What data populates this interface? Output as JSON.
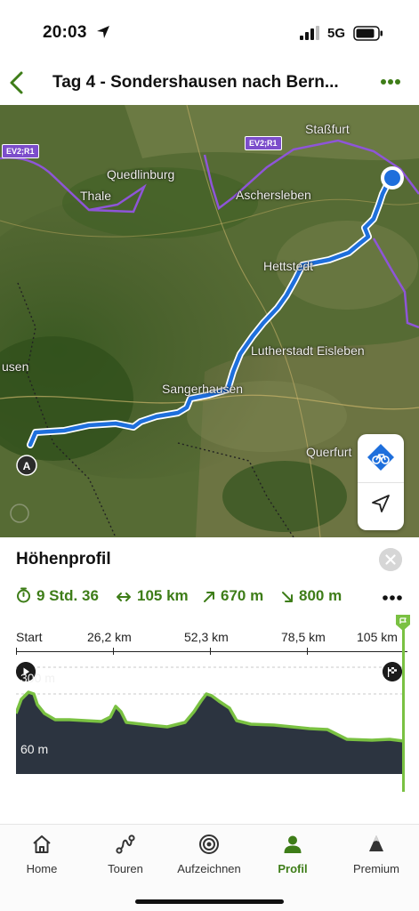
{
  "status_bar": {
    "time": "20:03",
    "network": "5G"
  },
  "nav": {
    "title": "Tag 4 - Sondershausen nach Bern...",
    "back_icon": "chevron-left-icon",
    "more_icon": "more-dots-icon"
  },
  "map": {
    "places": [
      "Staßfurt",
      "Quedlinburg",
      "Thale",
      "Aschersleben",
      "Hettstedt",
      "Lutherstadt Eisleben",
      "Sangerhausen",
      "usen",
      "Querfurt"
    ],
    "route_badges": [
      "EV2;R1",
      "EV2;R1"
    ],
    "start_marker": "A",
    "route_color": "#1e6fdc",
    "boundary_color": "#8e55d8",
    "controls": {
      "bike_icon": "bike-layer-icon",
      "locate_icon": "location-arrow-icon"
    }
  },
  "elevation": {
    "title": "Höhenprofil",
    "stats": {
      "duration": "9 Std. 36",
      "distance": "105 km",
      "ascent": "670 m",
      "descent": "800 m"
    },
    "axis_labels": [
      "Start",
      "26,2 km",
      "52,3 km",
      "78,5 km",
      "105 km"
    ],
    "y_labels": [
      "300 m",
      "60 m"
    ],
    "profile_color": "#7ac142",
    "fill_color": "#2c3440",
    "accent_color": "#3e7d18"
  },
  "tabs": [
    {
      "label": "Home",
      "icon": "home-icon",
      "active": false
    },
    {
      "label": "Touren",
      "icon": "route-icon",
      "active": false
    },
    {
      "label": "Aufzeichnen",
      "icon": "record-icon",
      "active": false
    },
    {
      "label": "Profil",
      "icon": "profile-icon",
      "active": true
    },
    {
      "label": "Premium",
      "icon": "premium-icon",
      "active": false
    }
  ]
}
